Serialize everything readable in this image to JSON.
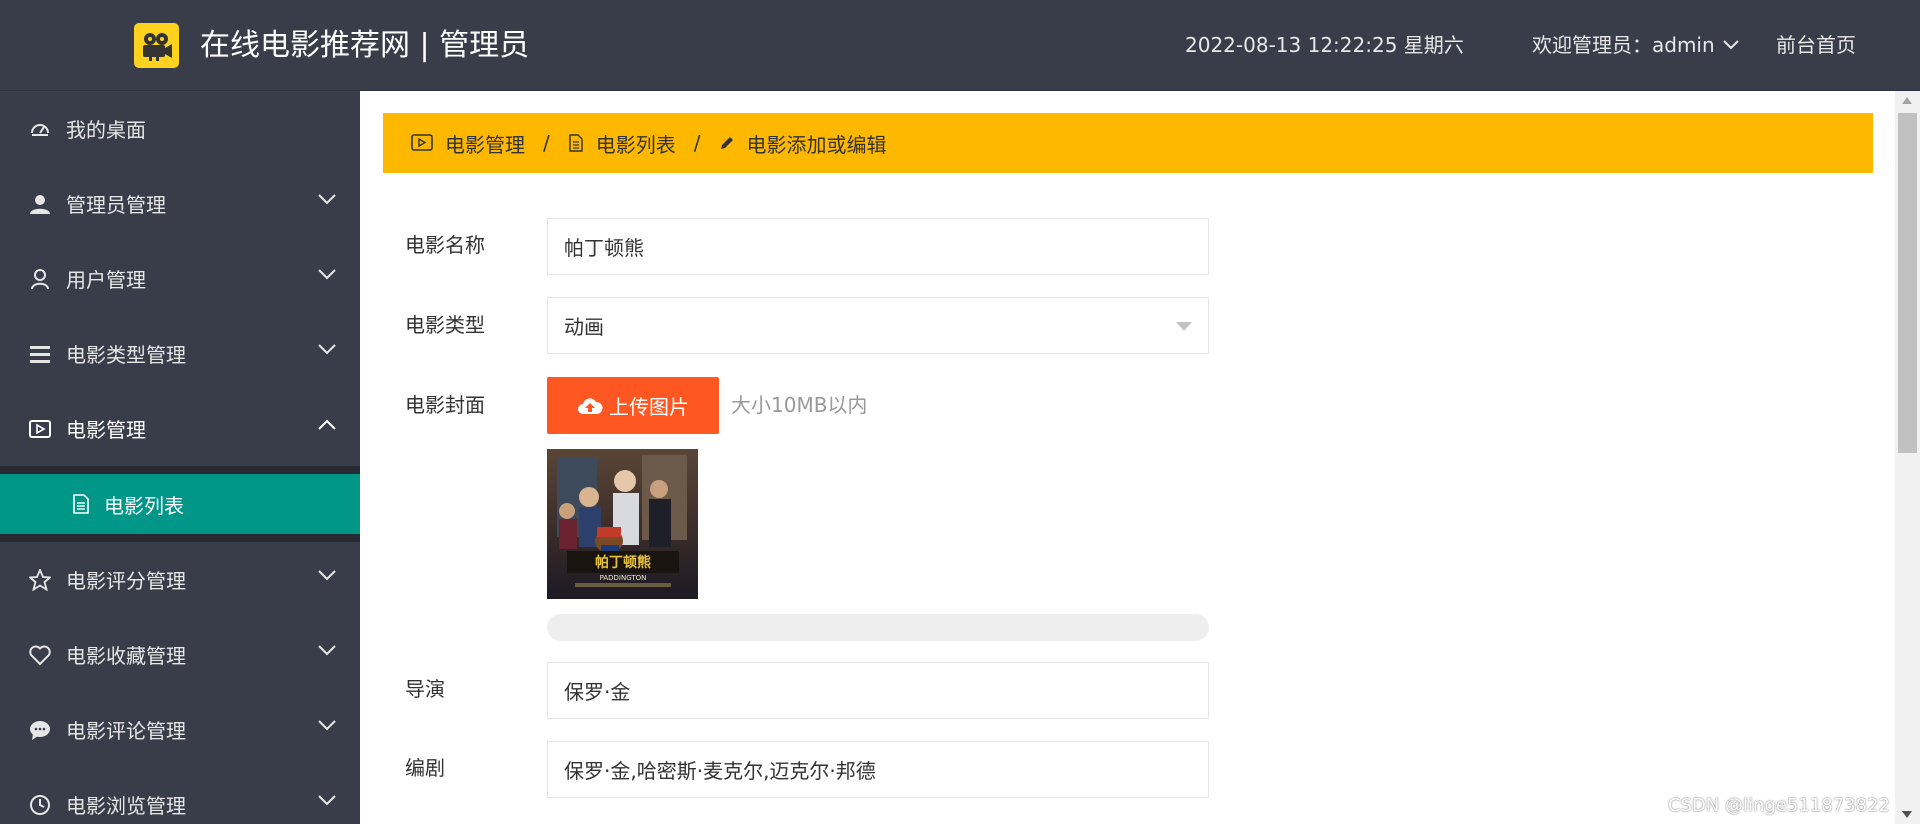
{
  "header": {
    "title": "在线电影推荐网 | 管理员",
    "datetime": "2022-08-13  12:22:25  星期六",
    "welcome": "欢迎管理员：admin",
    "frontpage": "前台首页",
    "colors": {
      "background": "#393d49",
      "logo": "#ffd21f"
    }
  },
  "sidebar": {
    "items": [
      {
        "label": "我的桌面",
        "icon": "dashboard-icon"
      },
      {
        "label": "管理员管理",
        "icon": "user-solid-icon"
      },
      {
        "label": "用户管理",
        "icon": "user-outline-icon"
      },
      {
        "label": "电影类型管理",
        "icon": "list-icon"
      },
      {
        "label": "电影管理",
        "icon": "video-icon"
      },
      {
        "label": "电影评分管理",
        "icon": "star-icon"
      },
      {
        "label": "电影收藏管理",
        "icon": "heart-icon"
      },
      {
        "label": "电影评论管理",
        "icon": "comment-icon"
      },
      {
        "label": "电影浏览管理",
        "icon": "clock-icon"
      }
    ],
    "active_sub": {
      "label": "电影列表",
      "icon": "document-icon"
    },
    "colors": {
      "background": "#393d49",
      "active": "#009688"
    }
  },
  "breadcrumb": {
    "items": [
      {
        "label": "电影管理",
        "icon": "video-icon"
      },
      {
        "label": "电影列表",
        "icon": "document-icon"
      },
      {
        "label": "电影添加或编辑",
        "icon": "pencil-icon"
      }
    ],
    "separator": "/",
    "color": "#ffb800"
  },
  "form": {
    "name": {
      "label": "电影名称",
      "value": "帕丁顿熊"
    },
    "type": {
      "label": "电影类型",
      "value": "动画"
    },
    "cover": {
      "label": "电影封面",
      "upload_label": "上传图片",
      "tip": "大小10MB以内",
      "upload_progress": 0
    },
    "director": {
      "label": "导演",
      "value": "保罗·金"
    },
    "writer": {
      "label": "编剧",
      "value": "保罗·金,哈密斯·麦克尔,迈克尔·邦德"
    }
  },
  "watermark": "CSDN @linge511873822"
}
